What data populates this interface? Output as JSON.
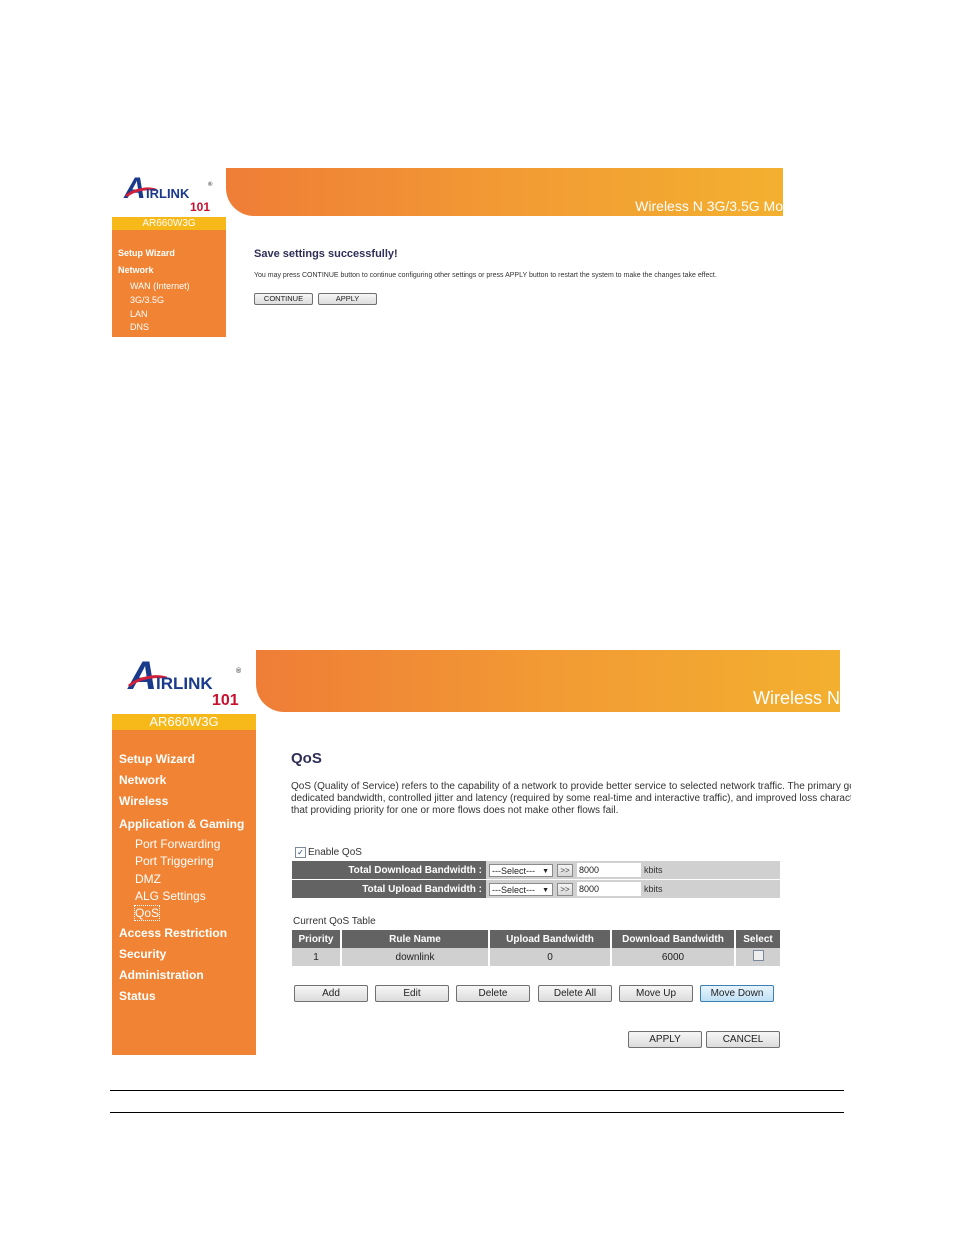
{
  "screen1": {
    "brand": {
      "letter_a": "A",
      "name": "IRLINK",
      "number": "101",
      "reg": "®"
    },
    "model": "AR660W3G",
    "banner_title": "Wireless N 3G/3.5G Mo",
    "sidebar": {
      "items": [
        {
          "label": "Setup Wizard"
        },
        {
          "label": "Network"
        }
      ],
      "subitems": [
        {
          "label": "WAN (Internet)"
        },
        {
          "label": "3G/3.5G"
        },
        {
          "label": "LAN"
        },
        {
          "label": "DNS"
        }
      ]
    },
    "heading": "Save settings successfully!",
    "message": "You may press CONTINUE button to continue configuring other settings or press APPLY button to restart the system to make the changes take effect.",
    "buttons": {
      "continue": "CONTINUE",
      "apply": "APPLY"
    }
  },
  "screen2": {
    "brand": {
      "letter_a": "A",
      "name": "IRLINK",
      "number": "101",
      "reg": "®"
    },
    "model": "AR660W3G",
    "banner_title": "Wireless N",
    "sidebar": {
      "items": [
        {
          "label": "Setup Wizard"
        },
        {
          "label": "Network"
        },
        {
          "label": "Wireless"
        },
        {
          "label": "Application & Gaming"
        },
        {
          "label": "Access Restriction"
        },
        {
          "label": "Security"
        },
        {
          "label": "Administration"
        },
        {
          "label": "Status"
        }
      ],
      "subitems": [
        {
          "label": "Port Forwarding"
        },
        {
          "label": "Port Triggering"
        },
        {
          "label": "DMZ"
        },
        {
          "label": "ALG Settings"
        },
        {
          "label": "QoS",
          "active": true
        }
      ]
    },
    "heading": "QoS",
    "description_lines": [
      "QoS (Quality of Service) refers to the capability of a network to provide better service to selected network traffic. The primary gc",
      "dedicated bandwidth, controlled jitter and latency (required by some real-time and interactive traffic), and improved loss charact",
      "that providing priority for one or more flows does not make other flows fail."
    ],
    "enable_qos": {
      "label": "Enable QoS",
      "checked": true,
      "check_glyph": "✓"
    },
    "bandwidth": [
      {
        "label": "Total Download Bandwidth :",
        "select": "---Select---",
        "go": ">>",
        "value": "8000",
        "unit": "kbits"
      },
      {
        "label": "Total Upload Bandwidth :",
        "select": "---Select---",
        "go": ">>",
        "value": "8000",
        "unit": "kbits"
      }
    ],
    "table_caption": "Current QoS Table",
    "table": {
      "headers": [
        "Priority",
        "Rule Name",
        "Upload Bandwidth",
        "Download Bandwidth",
        "Select"
      ],
      "rows": [
        {
          "priority": "1",
          "rule_name": "downlink",
          "upload": "0",
          "download": "6000",
          "selected": false
        }
      ]
    },
    "actions": {
      "add": "Add",
      "edit": "Edit",
      "delete": "Delete",
      "delete_all": "Delete All",
      "move_up": "Move Up",
      "move_down": "Move Down"
    },
    "footer_buttons": {
      "apply": "APPLY",
      "cancel": "CANCEL"
    }
  },
  "colors": {
    "sidebar": "#f08434",
    "model_bar": "#f7b81a",
    "table_header": "#636363",
    "table_cell": "#d0d0d0",
    "heading": "#2f2f58"
  }
}
